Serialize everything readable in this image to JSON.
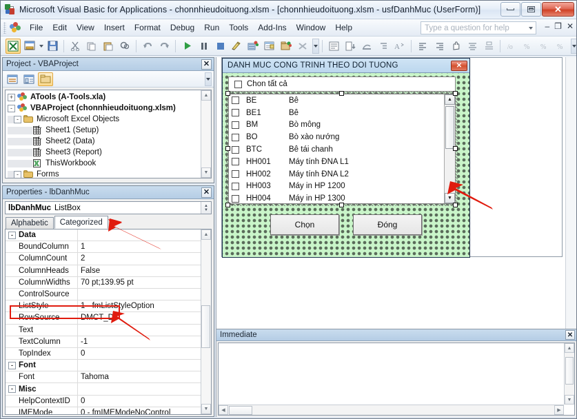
{
  "window": {
    "title": "Microsoft Visual Basic for Applications - chonnhieudoituong.xlsm - [chonnhieudoituong.xlsm - usfDanhMuc (UserForm)]",
    "icon": "vba-excel-icon",
    "buttons": {
      "minimize": "–",
      "maximize": "□",
      "close": "✕"
    }
  },
  "menubar": {
    "items": [
      {
        "label": "File",
        "accel": "F"
      },
      {
        "label": "Edit",
        "accel": "E"
      },
      {
        "label": "View",
        "accel": "V"
      },
      {
        "label": "Insert",
        "accel": "I"
      },
      {
        "label": "Format",
        "accel": "o"
      },
      {
        "label": "Debug",
        "accel": "D"
      },
      {
        "label": "Run",
        "accel": "R"
      },
      {
        "label": "Tools",
        "accel": "T"
      },
      {
        "label": "Add-Ins",
        "accel": "A"
      },
      {
        "label": "Window",
        "accel": "W"
      },
      {
        "label": "Help",
        "accel": "H"
      }
    ],
    "help_placeholder": "Type a question for help",
    "mdi_buttons": {
      "minimize": "–",
      "restore": "❐",
      "close": "✕"
    }
  },
  "toolbar": {
    "items": [
      "view-excel-icon",
      "insert-userform-icon",
      "save-icon",
      "cut-icon",
      "copy-icon",
      "paste-icon",
      "find-icon",
      "undo-icon",
      "redo-icon",
      "run-icon",
      "break-icon",
      "reset-icon",
      "design-mode-icon",
      "project-explorer-icon",
      "properties-window-icon",
      "object-browser-icon",
      "toolbox-icon",
      "align-left-icon",
      "center-icon",
      "hand-icon",
      "list-icon",
      "tab-order-icon",
      "font-icon",
      "zoom-a-icon",
      "zoom-b-icon",
      "zoom-c-icon",
      "zoom-d-icon"
    ]
  },
  "project_panel": {
    "title": "Project - VBAProject",
    "close_label": "✕",
    "toolbar": [
      "view-code-icon",
      "view-object-icon",
      "toggle-folders-icon"
    ],
    "tree": [
      {
        "label": "ATools (A-Tools.xla)",
        "indent": 0,
        "expander": "+",
        "icon": "project-icon",
        "bold": true
      },
      {
        "label": "VBAProject (chonnhieudoituong.xlsm)",
        "indent": 0,
        "expander": "-",
        "icon": "project-icon",
        "bold": true
      },
      {
        "label": "Microsoft Excel Objects",
        "indent": 1,
        "expander": "-",
        "icon": "folder-icon",
        "bold": false
      },
      {
        "label": "Sheet1 (Setup)",
        "indent": 2,
        "expander": "",
        "icon": "sheet-icon",
        "bold": false
      },
      {
        "label": "Sheet2 (Data)",
        "indent": 2,
        "expander": "",
        "icon": "sheet-icon",
        "bold": false
      },
      {
        "label": "Sheet3 (Report)",
        "indent": 2,
        "expander": "",
        "icon": "sheet-icon",
        "bold": false
      },
      {
        "label": "ThisWorkbook",
        "indent": 2,
        "expander": "",
        "icon": "workbook-icon",
        "bold": false
      },
      {
        "label": "Forms",
        "indent": 1,
        "expander": "-",
        "icon": "folder-icon",
        "bold": false
      }
    ]
  },
  "properties_panel": {
    "title": "Properties - lbDanhMuc",
    "close_label": "✕",
    "object_name": "lbDanhMuc",
    "object_type": "ListBox",
    "tabs": [
      {
        "label": "Alphabetic",
        "active": false
      },
      {
        "label": "Categorized",
        "active": true
      }
    ],
    "rows": [
      {
        "category": true,
        "name": "Data",
        "value": "",
        "expander": "-"
      },
      {
        "category": false,
        "name": "BoundColumn",
        "value": "1"
      },
      {
        "category": false,
        "name": "ColumnCount",
        "value": "2"
      },
      {
        "category": false,
        "name": "ColumnHeads",
        "value": "False"
      },
      {
        "category": false,
        "name": "ColumnWidths",
        "value": "70 pt;139.95 pt"
      },
      {
        "category": false,
        "name": "ControlSource",
        "value": ""
      },
      {
        "category": false,
        "name": "ListStyle",
        "value": "1 - fmListStyleOption"
      },
      {
        "category": false,
        "name": "RowSource",
        "value": "DMCT_DT",
        "highlighted": true
      },
      {
        "category": false,
        "name": "Text",
        "value": ""
      },
      {
        "category": false,
        "name": "TextColumn",
        "value": "-1"
      },
      {
        "category": false,
        "name": "TopIndex",
        "value": "0"
      },
      {
        "category": true,
        "name": "Font",
        "value": "",
        "expander": "-"
      },
      {
        "category": false,
        "name": "Font",
        "value": "Tahoma"
      },
      {
        "category": true,
        "name": "Misc",
        "value": "",
        "expander": "-"
      },
      {
        "category": false,
        "name": "HelpContextID",
        "value": "0"
      },
      {
        "category": false,
        "name": "IMEMode",
        "value": "0 - fmIMEModeNoControl"
      }
    ]
  },
  "userform": {
    "title": "DANH MUC CONG TRINH THEO DOI TUONG",
    "close_label": "✕",
    "select_all": {
      "label": "Chon tất cả",
      "checked": false
    },
    "listbox": {
      "name": "lbDanhMuc",
      "columns": 2,
      "items": [
        {
          "code": "BE",
          "name": "Bê",
          "checked": false
        },
        {
          "code": "BE1",
          "name": "Bê",
          "checked": false
        },
        {
          "code": "BM",
          "name": "Bò mông",
          "checked": false
        },
        {
          "code": "BO",
          "name": "Bò xào nướng",
          "checked": false
        },
        {
          "code": "BTC",
          "name": "Bê tái chanh",
          "checked": false
        },
        {
          "code": "HH001",
          "name": "Máy tính ĐNA L1",
          "checked": false
        },
        {
          "code": "HH002",
          "name": "Máy tính ĐNA L2",
          "checked": false
        },
        {
          "code": "HH003",
          "name": "Máy in HP 1200",
          "checked": false
        },
        {
          "code": "HH004",
          "name": "Máy in HP 1300",
          "checked": false
        }
      ]
    },
    "buttons": [
      {
        "label": "Chọn"
      },
      {
        "label": "Đóng"
      }
    ]
  },
  "immediate_panel": {
    "title": "Immediate",
    "close_label": "✕",
    "content": ""
  },
  "colors": {
    "titlebar_accent": "#cf4126",
    "panel_title": "#b5cde5",
    "form_body": "#c9f5c9",
    "annotation_red": "#e01b0e",
    "selection_tab": "#ffffff"
  }
}
